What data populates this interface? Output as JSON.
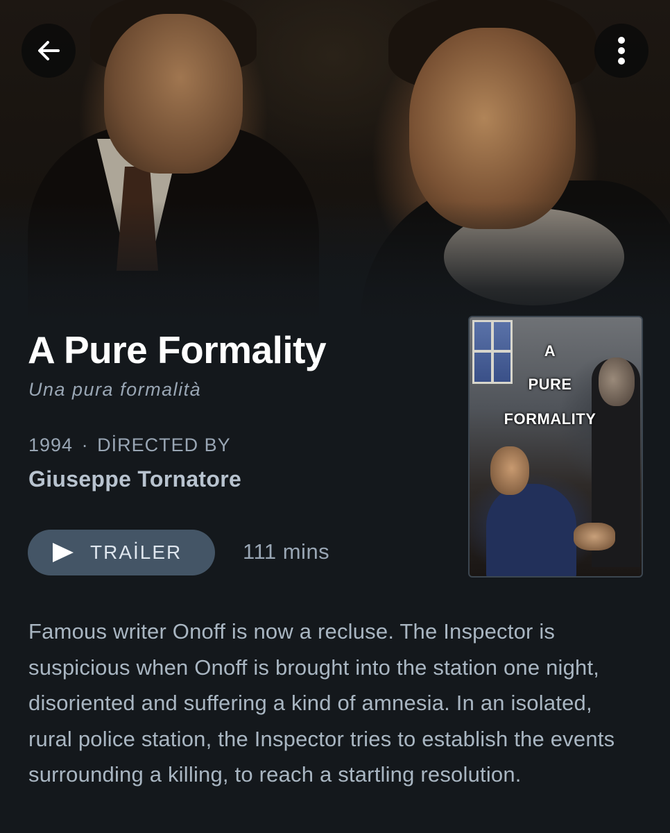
{
  "header": {
    "back_icon": "arrow-left-icon",
    "more_icon": "more-vertical-icon"
  },
  "film": {
    "title": "A Pure Formality",
    "original_title": "Una pura formalità",
    "year": "1994",
    "separator": "·",
    "directed_by_label": "DİRECTED BY",
    "director": "Giuseppe Tornatore",
    "runtime": "111 mins",
    "synopsis": "Famous writer Onoff is now a recluse. The Inspector is suspicious when Onoff is brought into the station one night, disoriented and suffering a kind of amnesia. In an isolated, rural police station, the Inspector tries to establish the events surrounding a killing, to reach a startling resolution."
  },
  "trailer": {
    "label": "TRAİLER",
    "icon": "play-icon"
  },
  "poster": {
    "line1": "A",
    "line2": "PURE",
    "line3": "FORMALITY"
  },
  "colors": {
    "background": "#14181c",
    "button": "#445566",
    "muted_text": "#99a6b4"
  }
}
